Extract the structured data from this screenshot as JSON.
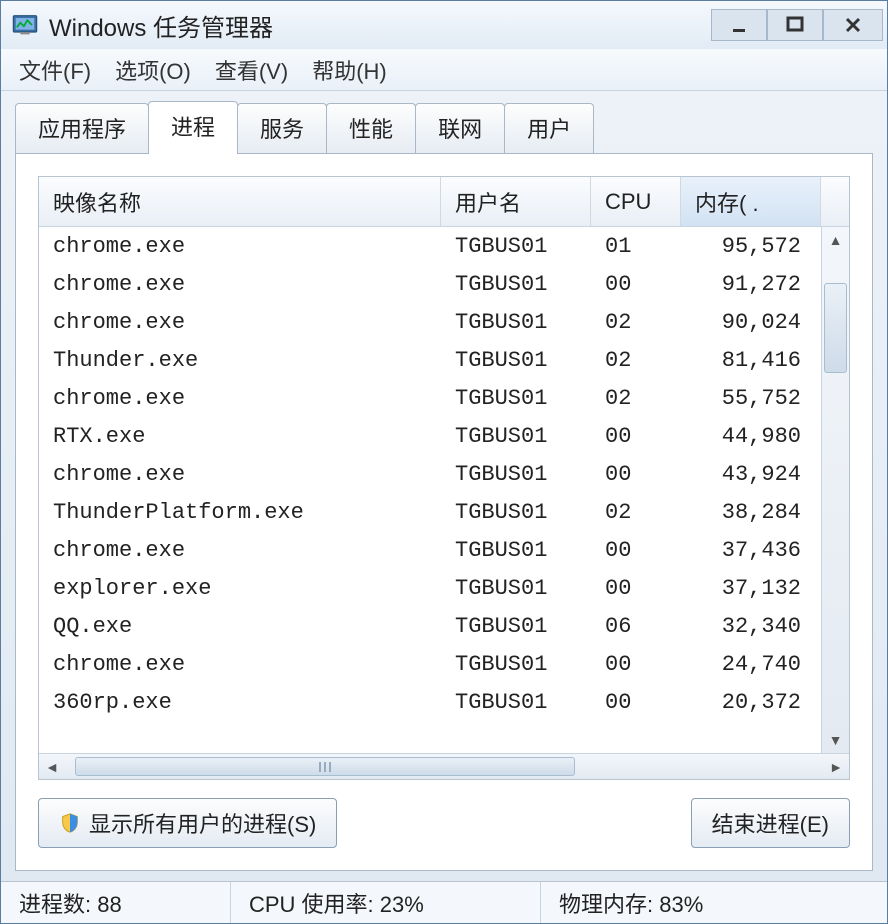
{
  "window": {
    "title": "Windows 任务管理器"
  },
  "menu": {
    "file": "文件(F)",
    "options": "选项(O)",
    "view": "查看(V)",
    "help": "帮助(H)"
  },
  "tabs": {
    "applications": "应用程序",
    "processes": "进程",
    "services": "服务",
    "performance": "性能",
    "networking": "联网",
    "users": "用户"
  },
  "columns": {
    "image_name": "映像名称",
    "user_name": "用户名",
    "cpu": "CPU",
    "memory": "内存( ."
  },
  "processes": [
    {
      "name": "chrome.exe",
      "user": "TGBUS01",
      "cpu": "01",
      "mem": "95,572"
    },
    {
      "name": "chrome.exe",
      "user": "TGBUS01",
      "cpu": "00",
      "mem": "91,272"
    },
    {
      "name": "chrome.exe",
      "user": "TGBUS01",
      "cpu": "02",
      "mem": "90,024"
    },
    {
      "name": "Thunder.exe",
      "user": "TGBUS01",
      "cpu": "02",
      "mem": "81,416"
    },
    {
      "name": "chrome.exe",
      "user": "TGBUS01",
      "cpu": "02",
      "mem": "55,752"
    },
    {
      "name": "RTX.exe",
      "user": "TGBUS01",
      "cpu": "00",
      "mem": "44,980"
    },
    {
      "name": "chrome.exe",
      "user": "TGBUS01",
      "cpu": "00",
      "mem": "43,924"
    },
    {
      "name": "ThunderPlatform.exe",
      "user": "TGBUS01",
      "cpu": "02",
      "mem": "38,284"
    },
    {
      "name": "chrome.exe",
      "user": "TGBUS01",
      "cpu": "00",
      "mem": "37,436"
    },
    {
      "name": "explorer.exe",
      "user": "TGBUS01",
      "cpu": "00",
      "mem": "37,132"
    },
    {
      "name": "QQ.exe",
      "user": "TGBUS01",
      "cpu": "06",
      "mem": "32,340"
    },
    {
      "name": "chrome.exe",
      "user": "TGBUS01",
      "cpu": "00",
      "mem": "24,740"
    },
    {
      "name": "360rp.exe",
      "user": "TGBUS01",
      "cpu": "00",
      "mem": "20,372"
    }
  ],
  "buttons": {
    "show_all_users": "显示所有用户的进程(S)",
    "end_process": "结束进程(E)"
  },
  "statusbar": {
    "process_count": "进程数: 88",
    "cpu_usage": "CPU 使用率: 23%",
    "physical_memory": "物理内存: 83%"
  }
}
